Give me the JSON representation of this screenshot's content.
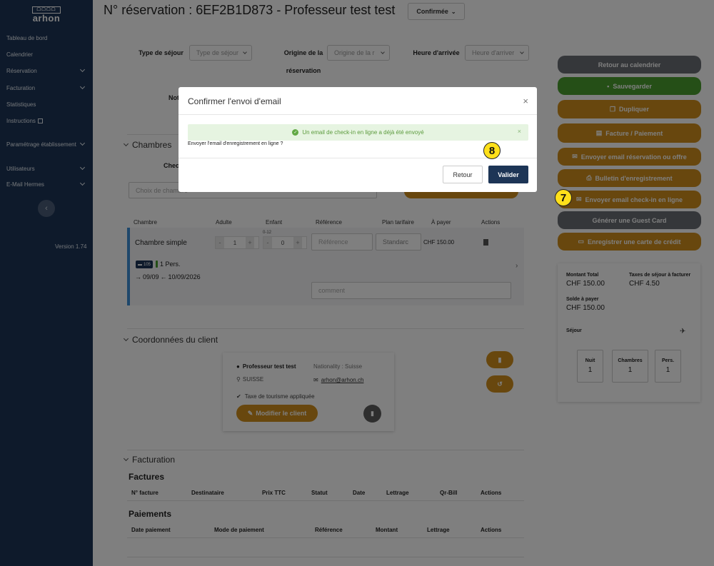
{
  "sidebar": {
    "logo_top": "ᗝᗝᗝᗝ",
    "logo_word": "arhon",
    "items": [
      {
        "label": "Tableau de bord"
      },
      {
        "label": "Calendrier"
      },
      {
        "label": "Réservation"
      },
      {
        "label": "Facturation"
      },
      {
        "label": "Statistiques"
      },
      {
        "label": "Instructions"
      },
      {
        "label": "Paramétrage établissement"
      },
      {
        "label": "Utilisateurs"
      },
      {
        "label": "E-Mail Hermes"
      }
    ],
    "version": "Version 1.74"
  },
  "header": {
    "title": "N° réservation : 6EF2B1D873 - Professeur test test",
    "status": "Confirmée"
  },
  "form": {
    "type_sejour_label": "Type de séjour",
    "type_sejour_placeholder": "Type de séjour",
    "origine_label_1": "Origine de la",
    "origine_label_2": "réservation",
    "origine_placeholder": "Origine de la r",
    "heure_label": "Heure d'arrivée",
    "heure_placeholder": "Heure d'arriver",
    "notes_label": "Not"
  },
  "chambres": {
    "title": "Chambres",
    "checkin_label": "Checl",
    "select_placeholder": "Choix de chambre",
    "headers": [
      "Chambre",
      "Adulte",
      "Enfant",
      "Référence",
      "Plan tarifaire",
      "À payer",
      "Actions"
    ],
    "room": {
      "name": "Chambre simple",
      "adults": "1",
      "child_range": "0-12",
      "children": "0",
      "reference_placeholder": "Référence",
      "plan": "Standarc",
      "price": "CHF 150.00",
      "bed_tag": "105",
      "persons": "1 Pers.",
      "arrive": "09/09",
      "depart": "10/09/2026",
      "comment_placeholder": "comment"
    }
  },
  "client": {
    "title": "Coordonnées du client",
    "name": "Professeur  test test",
    "nationality": "Nationality : Suisse",
    "country": "SUISSE",
    "email": "arhon@arhon.ch",
    "tax": "Taxe de tourisme appliquée",
    "edit_label": "Modifier le client"
  },
  "facturation": {
    "title": "Facturation",
    "factures_title": "Factures",
    "factures_headers": [
      "N° facture",
      "Destinataire",
      "Prix TTC",
      "Statut",
      "Date",
      "Lettrage",
      "Qr-Bill",
      "Actions"
    ],
    "paiements_title": "Paiements",
    "paiements_headers": [
      "Date paiement",
      "Mode de paiement",
      "Référence",
      "Montant",
      "Lettrage",
      "Actions"
    ]
  },
  "actions": {
    "retour": "Retour au calendrier",
    "sauvegarder": "Sauvegarder",
    "dupliquer": "Dupliquer",
    "facture": "Facture / Paiement",
    "envoyer_resa": "Envoyer email réservation ou offre",
    "bulletin": "Bulletin d'enregistrement",
    "envoyer_checkin": "Envoyer email check-in en ligne",
    "guest_card": "Générer une Guest Card",
    "carte_credit": "Enregistrer une carte de crédit"
  },
  "summary": {
    "montant_label": "Montant Total",
    "montant": "CHF 150.00",
    "taxes_label": "Taxes de séjour à facturer",
    "taxes": "CHF 4.50",
    "solde_label": "Solde à payer",
    "solde": "CHF 150.00",
    "sejour_label": "Séjour",
    "nuit_label": "Nuit",
    "nuit": "1",
    "chambres_label": "Chambres",
    "chambres": "1",
    "pers_label": "Pers.",
    "pers": "1"
  },
  "modal": {
    "title": "Confirmer l'envoi d'email",
    "alert": "Un email de check-in en ligne a déjà été envoyé",
    "question": "Envoyer l'email d'enregistrement en ligne ?",
    "cancel": "Retour",
    "confirm": "Valider"
  },
  "badges": {
    "seven": "7",
    "eight": "8"
  },
  "colors": {
    "sidebar": "#1d3556",
    "gold": "#d18f1c",
    "green": "#4a9e2e",
    "gray": "#6b6e74",
    "navy": "#1d3556",
    "badge": "#ffe01a"
  }
}
